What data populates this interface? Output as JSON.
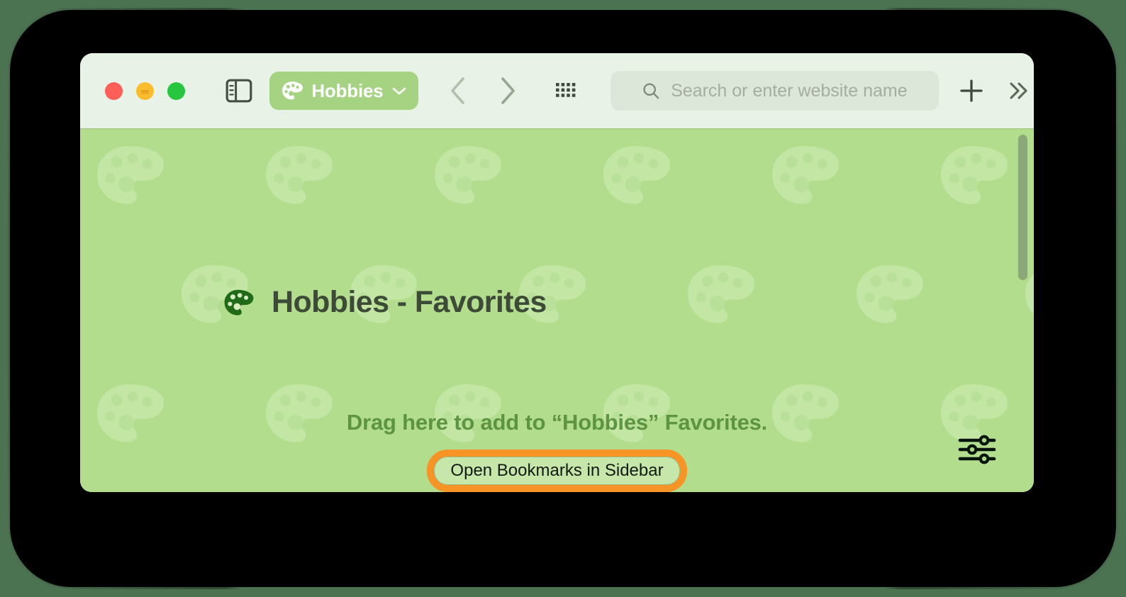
{
  "window": {
    "traffic_lights": [
      {
        "name": "close",
        "color": "#ff5f57"
      },
      {
        "name": "minimize",
        "color": "#fdbc2e"
      },
      {
        "name": "zoom",
        "color": "#26c73f"
      }
    ]
  },
  "toolbar": {
    "sidebar_toggle_icon": "sidebar-icon",
    "profile": {
      "icon": "palette-icon",
      "label": "Hobbies",
      "chevron_icon": "chevron-down-icon",
      "background_color": "#a6d382"
    },
    "back_icon": "chevron-left-icon",
    "forward_icon": "chevron-right-icon",
    "grid_icon": "tab-overview-grid-icon",
    "address_bar": {
      "search_icon": "search-icon",
      "placeholder": "Search or enter website name",
      "value": ""
    },
    "new_tab_icon": "plus-icon",
    "more_icon": "double-chevron-right-icon"
  },
  "content": {
    "page_icon": "palette-icon",
    "page_title": "Hobbies - Favorites",
    "drag_hint": "Drag here to add to “Hobbies” Favorites.",
    "open_bookmarks_label": "Open Bookmarks in Sidebar",
    "settings_icon": "sliders-icon",
    "wallpaper_icon": "palette-icon",
    "background_color": "#b2dd8d",
    "focus_ring_color": "#f79426",
    "scrollbar": {
      "visible": true
    }
  }
}
